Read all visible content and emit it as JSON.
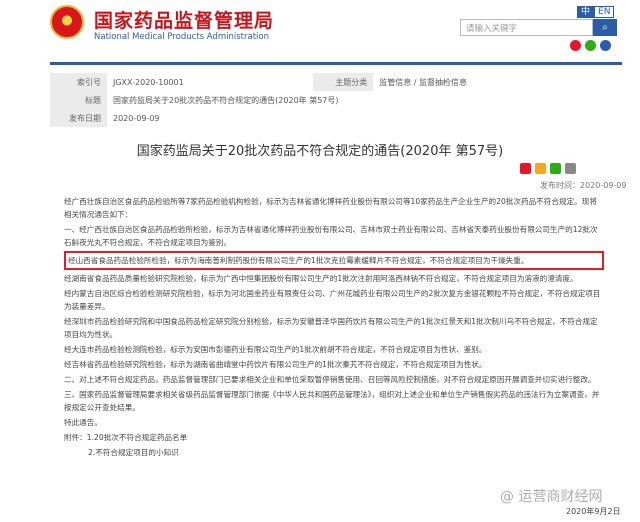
{
  "header": {
    "title_cn": "国家药品监督管理局",
    "title_en": "National Medical Products Administration",
    "lang_zh": "中",
    "lang_en": "EN",
    "search_placeholder": "请输入关键字",
    "search_icon": "search-icon"
  },
  "meta": {
    "index_label": "索引号",
    "index_value": "JGXX-2020-10001",
    "category_label": "主题分类",
    "category_value": "监管信息 / 监督抽检信息",
    "title_label": "标题",
    "title_value": "国家药监局关于20批次药品不符合规定的通告(2020年 第57号)",
    "date_label": "发布日期",
    "date_value": "2020-09-09"
  },
  "article": {
    "title": "国家药监局关于20批次药品不符合规定的通告(2020年 第57号)",
    "published": "发布时间：2020-09-09",
    "paragraphs": [
      "经广西壮族自治区食品药品检验所等7家药品检验机构检验，标示为吉林省通化博祥药业股份有限公司等10家药品生产企业生产的20批次药品不符合规定。现将相关情况通告如下：",
      "一、经广西壮族自治区食品药品检验所检验，标示为吉林省通化博祥药业股份有限公司、吉林市双士药业有限公司、吉林省天泰药业股份有限公司生产的12批次石斛夜光丸不符合规定，不符合规定项目为鉴别。",
      "经山西省食品药品检验所检验，标示为海南普利制药股份有限公司生产的1批次克拉霉素缓释片不符合规定，不符合规定项目为干燥失重。",
      "经湖南省食品药品质量检验研究院检验，标示为广西中恒集团股份有限公司生产的1批次注射用阿洛西林钠不符合规定，不符合规定项目为溶液的澄清度。",
      "经内蒙古自治区综合检验检测研究院检验，标示为河北国金药业有限责任公司、广州花城药业有限公司生产的2批次复方金银花颗粒不符合规定，不符合规定项目为装量差异。",
      "经深圳市药品检验研究院和中国食品药品检定研究院分别检验，标示为安徽普泽华国药饮片有限公司生产的1批次红景天和1批次制川乌不符合规定，不符合规定项目均为性状。",
      "经大连市药品检验检测院检验，标示为安国市彭德药业有限公司生产的1批次前胡不符合规定，不符合规定项目为性状、鉴别。",
      "经吉林省药品检验研究院检验，标示为湖南省曲靖堂中药饮片有限公司生产的1批次秦艽不符合规定，不符合规定项目为性状。",
      "二、对上述不符合规定药品，药品监督管理部门已要求相关企业和单位采取暂停销售使用、召回等风险控制措施，对不符合规定原因开展调查并切实进行整改。",
      "三、国家药品监督管理局要求相关省级药品监督管理部门依据《中华人民共和国药品管理法》，组织对上述企业和单位生产销售假劣药品的违法行为立案调查，并按规定公开查处结果。",
      "特此通告。",
      "附件：1.20批次不符合规定药品名单",
      "2.不符合规定项目的小知识"
    ],
    "sign_date": "2020年9月2日",
    "watermark": "@ 运营商财经网"
  },
  "colors": {
    "brand_red": "#c4161c",
    "brand_blue": "#2a5da8",
    "highlight": "#e02020"
  }
}
